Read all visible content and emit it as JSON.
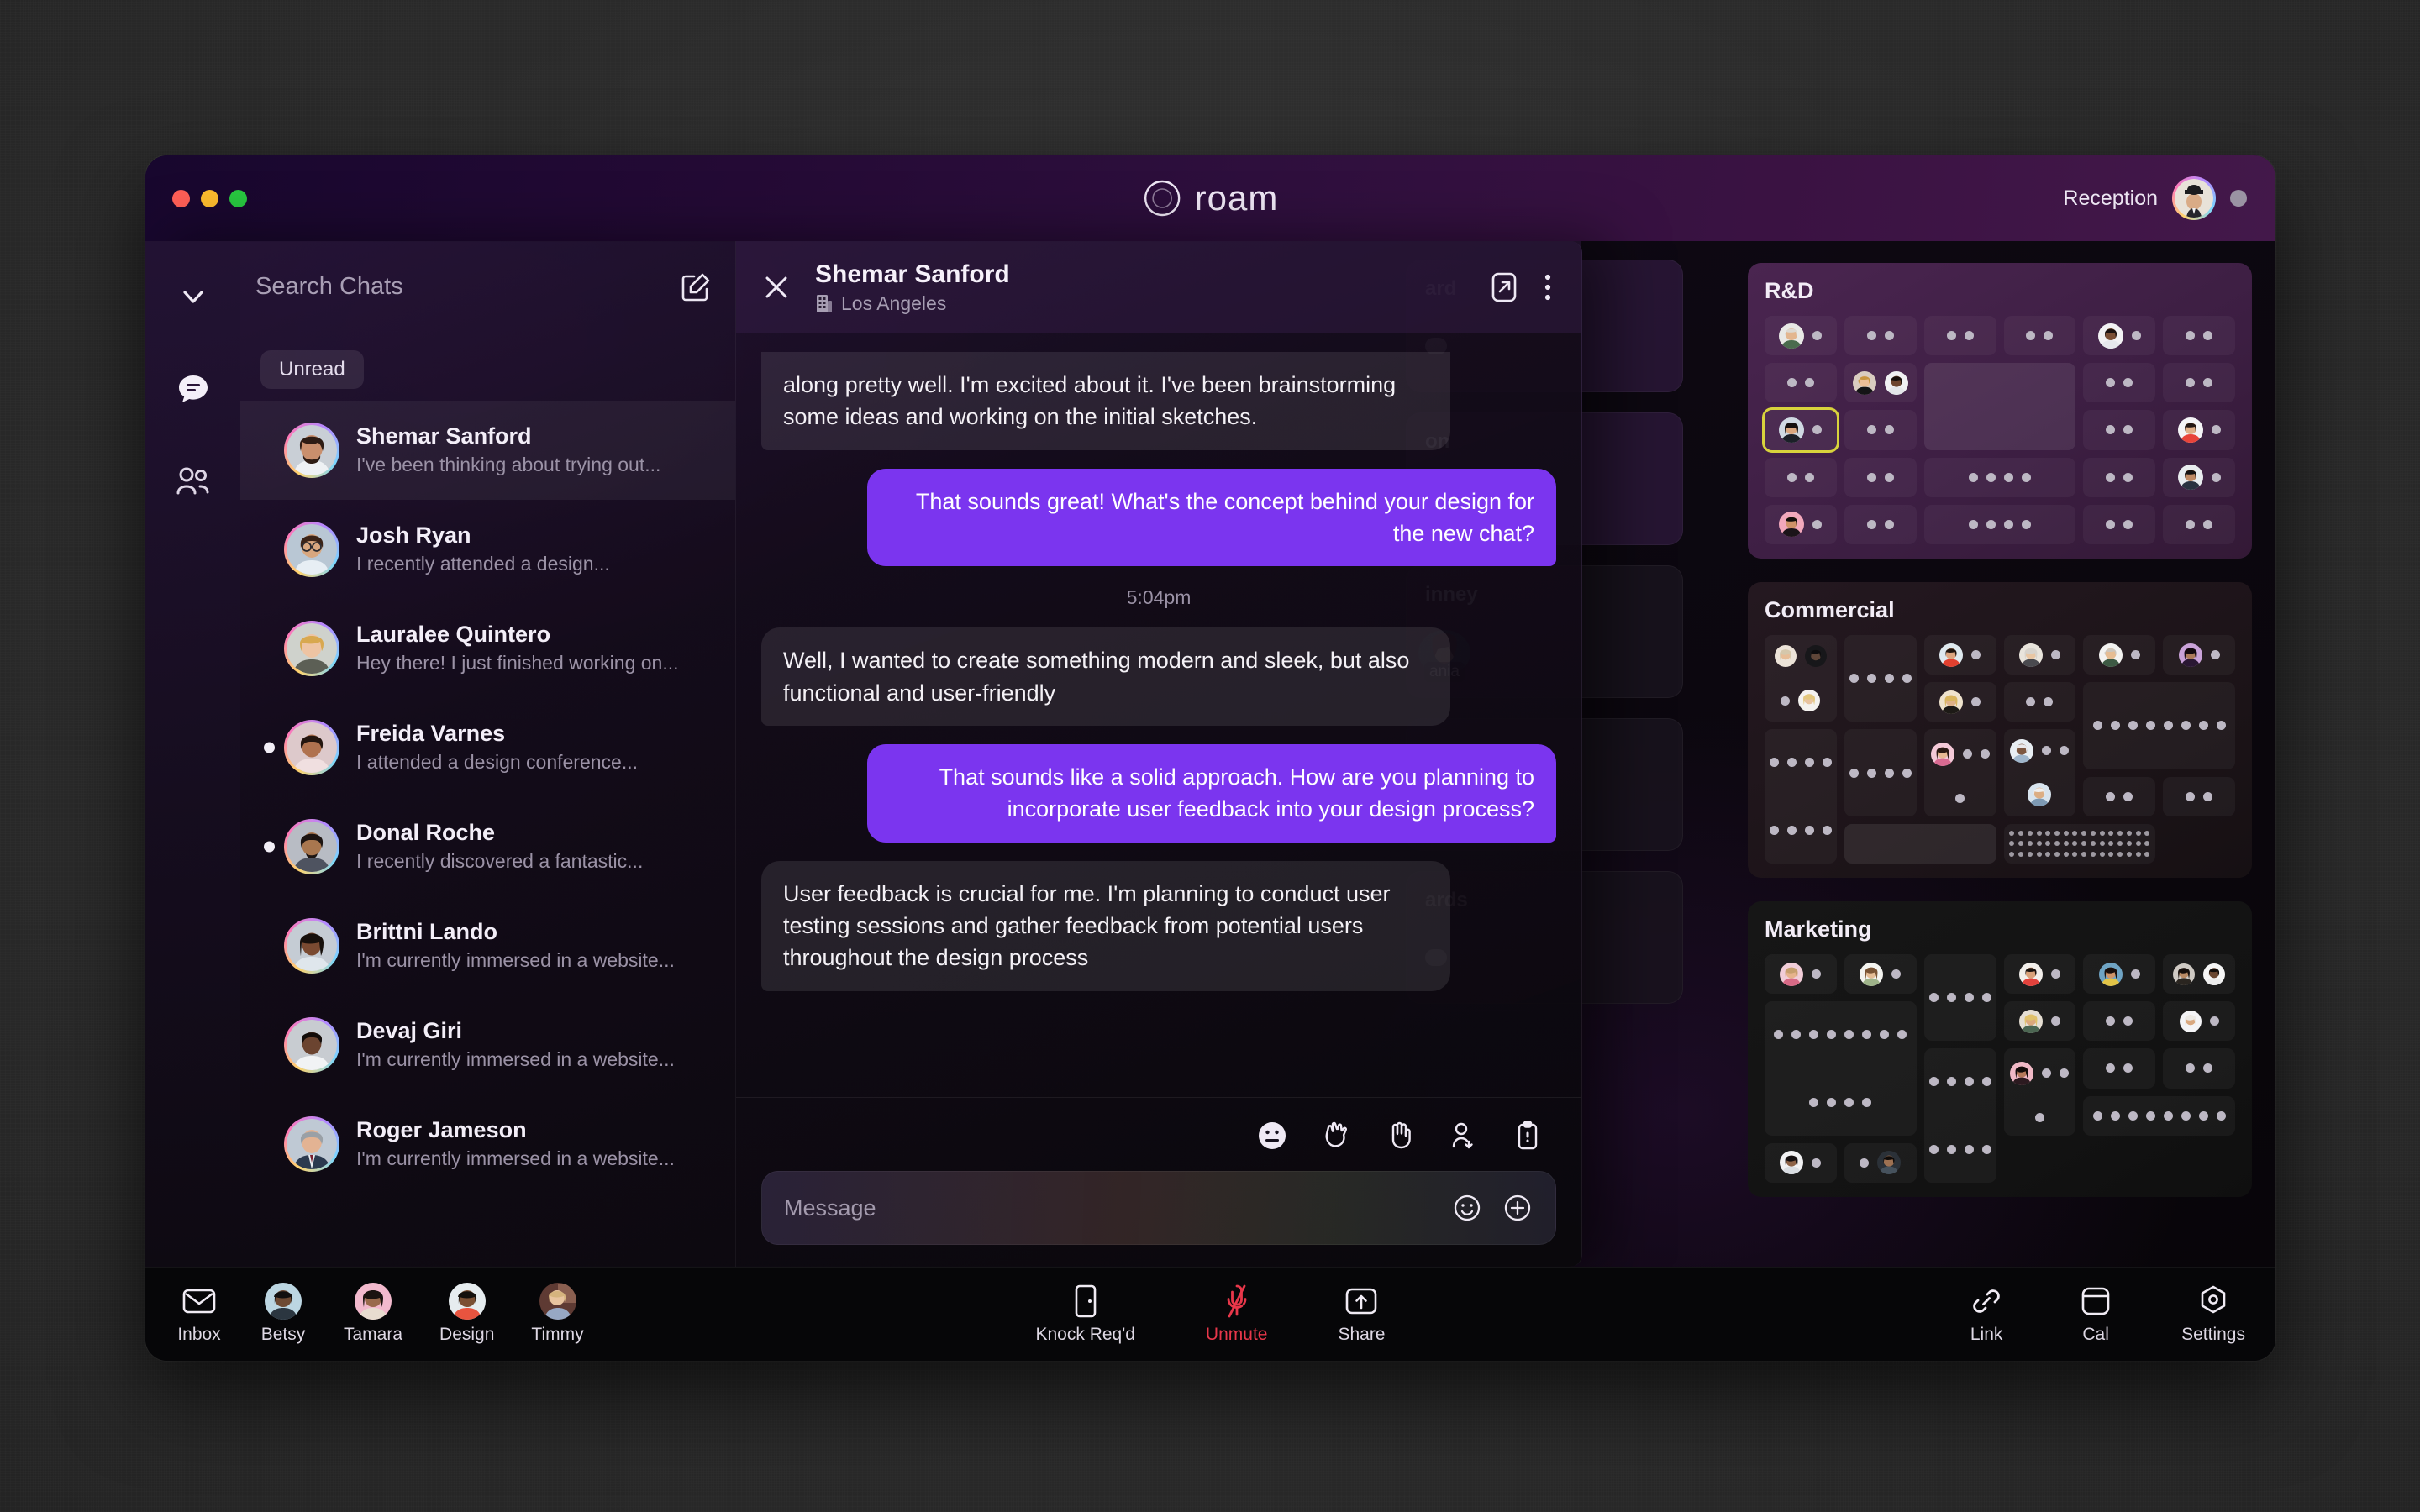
{
  "window": {
    "traffic_lights": [
      "close",
      "minimize",
      "maximize"
    ],
    "brand_name": "roam",
    "reception_label": "Reception"
  },
  "sidebar_rail": {
    "items": [
      {
        "icon": "chevron-down-icon",
        "name": "collapse"
      },
      {
        "icon": "chat-bubble-icon",
        "name": "chats",
        "active": true
      },
      {
        "icon": "people-icon",
        "name": "contacts",
        "active": false
      }
    ]
  },
  "search": {
    "placeholder": "Search Chats",
    "value": "",
    "compose_icon": "compose-icon"
  },
  "filters": {
    "unread_label": "Unread"
  },
  "conversations": [
    {
      "name": "Shemar Sanford",
      "preview": "I've been thinking about trying out...",
      "unread": false,
      "active": true
    },
    {
      "name": "Josh Ryan",
      "preview": "I recently attended a design...",
      "unread": false,
      "active": false
    },
    {
      "name": "Lauralee Quintero",
      "preview": "Hey there! I just finished working on...",
      "unread": false,
      "active": false
    },
    {
      "name": "Freida Varnes",
      "preview": "I attended a design conference...",
      "unread": true,
      "active": false
    },
    {
      "name": "Donal Roche",
      "preview": "I recently discovered a fantastic...",
      "unread": true,
      "active": false
    },
    {
      "name": "Brittni Lando",
      "preview": "I'm currently immersed in a website...",
      "unread": false,
      "active": false
    },
    {
      "name": "Devaj Giri",
      "preview": "I'm currently immersed in a website...",
      "unread": false,
      "active": false
    },
    {
      "name": "Roger Jameson",
      "preview": "I'm currently immersed in a website...",
      "unread": false,
      "active": false
    }
  ],
  "thread": {
    "title": "Shemar Sanford",
    "location": "Los Angeles",
    "location_icon": "building-icon",
    "close_icon": "close-icon",
    "popout_icon": "pop-out-icon",
    "more_icon": "more-vertical-icon",
    "timestamp": "5:04pm",
    "messages": [
      {
        "from": "them",
        "text": "along pretty well. I'm excited about it. I've been brainstorming some ideas and working on the initial sketches.",
        "clipped": true
      },
      {
        "from": "me",
        "text": "That sounds great! What's the concept behind your design for the new chat?"
      },
      {
        "from": "them",
        "text": "Well, I wanted to create something modern and sleek, but also functional and user-friendly"
      },
      {
        "from": "me",
        "text": "That sounds like a solid approach. How are you planning to incorporate user feedback into your design process?"
      },
      {
        "from": "them",
        "text": "User feedback is crucial for me. I'm planning to conduct user testing sessions and gather feedback from potential users throughout the design process"
      }
    ]
  },
  "reactions": [
    {
      "icon": "emoji-face-icon",
      "name": "emoji-reaction"
    },
    {
      "icon": "clap-icon",
      "name": "clap-reaction"
    },
    {
      "icon": "wave-hand-icon",
      "name": "wave-reaction"
    },
    {
      "icon": "person-leave-icon",
      "name": "leave-reaction"
    },
    {
      "icon": "clipboard-icon",
      "name": "clipboard-reaction"
    }
  ],
  "composer": {
    "placeholder": "Message",
    "value": "",
    "emoji_icon": "emoji-icon",
    "add_icon": "plus-circle-icon"
  },
  "rooms_background": [
    {
      "title": "ard",
      "has_seat": true,
      "tone": "light"
    },
    {
      "title": "on",
      "has_seat": true,
      "tone": "light"
    },
    {
      "title": "inney",
      "person": "ania",
      "tone": "dark"
    },
    {
      "title": "",
      "has_seat": true,
      "tone": "dark"
    },
    {
      "title": "ards",
      "has_seat": true,
      "tone": "dark"
    }
  ],
  "floor_map": {
    "sections": [
      {
        "title": "R&D",
        "theme": "rd",
        "desks": [
          {
            "seats": 2,
            "occupants": 1
          },
          {
            "seats": 2,
            "occupants": 0
          },
          {
            "seats": 2,
            "occupants": 0
          },
          {
            "seats": 2,
            "occupants": 0
          },
          {
            "seats": 2,
            "occupants": 1
          },
          {
            "seats": 2,
            "occupants": 0
          },
          {
            "seats": 2,
            "occupants": 0
          },
          {
            "seats": 0,
            "occupants": 2
          },
          {
            "seats": 0,
            "occupants": 0,
            "room": true,
            "span_col": 2,
            "span_row": 2
          },
          {
            "seats": 2,
            "occupants": 0
          },
          {
            "seats": 2,
            "occupants": 0
          },
          {
            "seats": 2,
            "occupants": 0,
            "selected": true
          },
          {
            "seats": 2,
            "occupants": 0
          },
          {
            "seats": 2,
            "occupants": 0
          },
          {
            "seats": 2,
            "occupants": 1
          },
          {
            "seats": 2,
            "occupants": 0
          },
          {
            "seats": 2,
            "occupants": 0
          },
          {
            "seats": 4,
            "occupants": 0,
            "span_col": 2
          },
          {
            "seats": 2,
            "occupants": 0
          },
          {
            "seats": 2,
            "occupants": 1
          },
          {
            "seats": 2,
            "occupants": 1
          },
          {
            "seats": 2,
            "occupants": 0
          },
          {
            "seats": 4,
            "occupants": 0,
            "span_col": 2
          },
          {
            "seats": 2,
            "occupants": 0
          },
          {
            "seats": 2,
            "occupants": 0
          }
        ]
      },
      {
        "title": "Commercial",
        "theme": "commercial",
        "desks": [
          {
            "seats": 2,
            "occupants": 3,
            "span_row": 2
          },
          {
            "seats": 4,
            "occupants": 0,
            "span_row": 2
          },
          {
            "seats": 2,
            "occupants": 1
          },
          {
            "seats": 2,
            "occupants": 1
          },
          {
            "seats": 2,
            "occupants": 1
          },
          {
            "seats": 2,
            "occupants": 1
          },
          {
            "seats": 2,
            "occupants": 1
          },
          {
            "seats": 2,
            "occupants": 0
          },
          {
            "seats": 8,
            "occupants": 0,
            "span_col": 2,
            "span_row": 2
          },
          {
            "seats": 4,
            "occupants": 1,
            "span_row": 2
          },
          {
            "seats": 4,
            "occupants": 0,
            "span_row": 2
          },
          {
            "seats": 8,
            "occupants": 0,
            "span_row": 3
          },
          {
            "seats": 2,
            "occupants": 1
          },
          {
            "seats": 2,
            "occupants": 0
          },
          {
            "seats": 0,
            "occupants": 0,
            "dense": true,
            "span_col": 2,
            "span_row": 2
          },
          {
            "seats": 4,
            "occupants": 2,
            "span_row": 2
          },
          {
            "seats": 2,
            "occupants": 0
          },
          {
            "seats": 2,
            "occupants": 0
          }
        ]
      },
      {
        "title": "Marketing",
        "theme": "marketing",
        "desks": [
          {
            "seats": 2,
            "occupants": 1
          },
          {
            "seats": 2,
            "occupants": 1
          },
          {
            "seats": 4,
            "occupants": 0,
            "span_row": 2
          },
          {
            "seats": 2,
            "occupants": 1
          },
          {
            "seats": 2,
            "occupants": 1
          },
          {
            "seats": 2,
            "occupants": 2
          },
          {
            "seats": 12,
            "occupants": 0,
            "span_col": 2,
            "span_row": 3
          },
          {
            "seats": 2,
            "occupants": 1
          },
          {
            "seats": 2,
            "occupants": 0
          },
          {
            "seats": 2,
            "occupants": 1
          },
          {
            "seats": 8,
            "occupants": 0,
            "span_row": 3
          },
          {
            "seats": 6,
            "occupants": 0,
            "span_row": 2
          },
          {
            "seats": 2,
            "occupants": 1
          },
          {
            "seats": 2,
            "occupants": 1
          },
          {
            "seats": 2,
            "occupants": 0
          },
          {
            "seats": 2,
            "occupants": 1
          },
          {
            "seats": 8,
            "occupants": 0,
            "span_col": 2
          },
          {
            "seats": 2,
            "occupants": 0
          },
          {
            "seats": 2,
            "occupants": 1
          }
        ]
      }
    ]
  },
  "toolbar": {
    "left": [
      {
        "label": "Inbox",
        "icon": "mail-icon",
        "type": "icon"
      },
      {
        "label": "Betsy",
        "icon": "avatar",
        "type": "avatar"
      },
      {
        "label": "Tamara",
        "icon": "avatar",
        "type": "avatar"
      },
      {
        "label": "Design",
        "icon": "avatar",
        "type": "avatar"
      },
      {
        "label": "Timmy",
        "icon": "avatar",
        "type": "avatar"
      }
    ],
    "center": [
      {
        "label": "Knock Req'd",
        "icon": "door-icon",
        "danger": false
      },
      {
        "label": "Unmute",
        "icon": "mic-off-icon",
        "danger": true
      },
      {
        "label": "Share",
        "icon": "share-up-icon",
        "danger": false
      }
    ],
    "right": [
      {
        "label": "Link",
        "icon": "link-icon"
      },
      {
        "label": "Cal",
        "icon": "calendar-icon"
      },
      {
        "label": "Settings",
        "icon": "settings-gear-icon"
      }
    ]
  },
  "colors": {
    "accent_purple": "#7b35ef",
    "danger_red": "#e8374a",
    "selection_yellow": "#d8d33c"
  }
}
